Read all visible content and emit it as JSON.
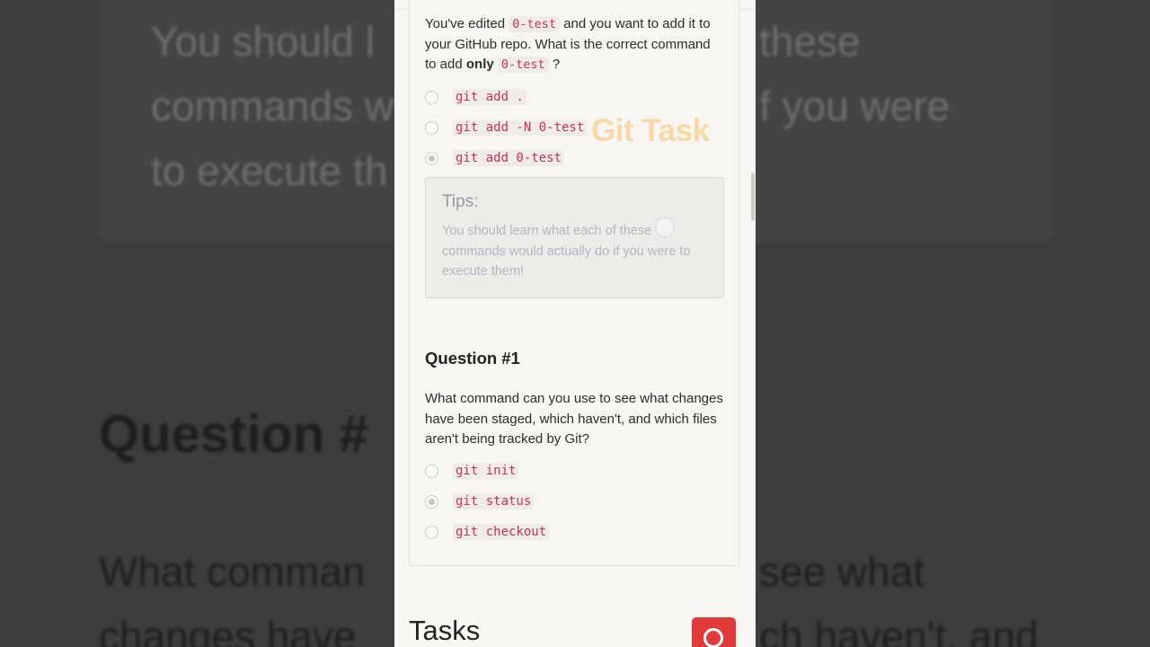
{
  "question0": {
    "prompt_part1": "You've edited",
    "prompt_code1": "0-test",
    "prompt_part2": "and you want to add it to your GitHub repo. What is the correct command to add",
    "prompt_bold": "only",
    "prompt_code2": "0-test",
    "prompt_part3": "?",
    "options": [
      {
        "label": "git add .",
        "selected": false
      },
      {
        "label": "git add -N 0-test",
        "selected": false
      },
      {
        "label": "git add 0-test",
        "selected": true
      }
    ],
    "tips_title": "Tips:",
    "tips_body": "You should learn what each of these commands would actually do if you were to execute them!"
  },
  "question1": {
    "heading": "Question #1",
    "text": "What command can you use to see what changes have been staged, which haven't, and which files aren't being tracked by Git?",
    "options": [
      {
        "label": "git init",
        "selected": false
      },
      {
        "label": "git status",
        "selected": true
      },
      {
        "label": "git checkout",
        "selected": false
      }
    ]
  },
  "watermark": "Git Task",
  "section_title": "Tasks",
  "background": {
    "tips_line1": "You should l",
    "tips_line2": "commands w",
    "tips_line3": "to execute th",
    "tips_right1": "these",
    "tips_right2": "f you were",
    "question": "Question #",
    "body_line1": "What comman",
    "body_line2": "changes have",
    "body_right1": "see what",
    "body_right2": "ch haven't, and"
  },
  "colors": {
    "accent_red": "#e23a3a",
    "code_pink": "#c0345d",
    "watermark_orange": "#f6d9a6"
  },
  "icons": {
    "search_button": "search-icon"
  }
}
